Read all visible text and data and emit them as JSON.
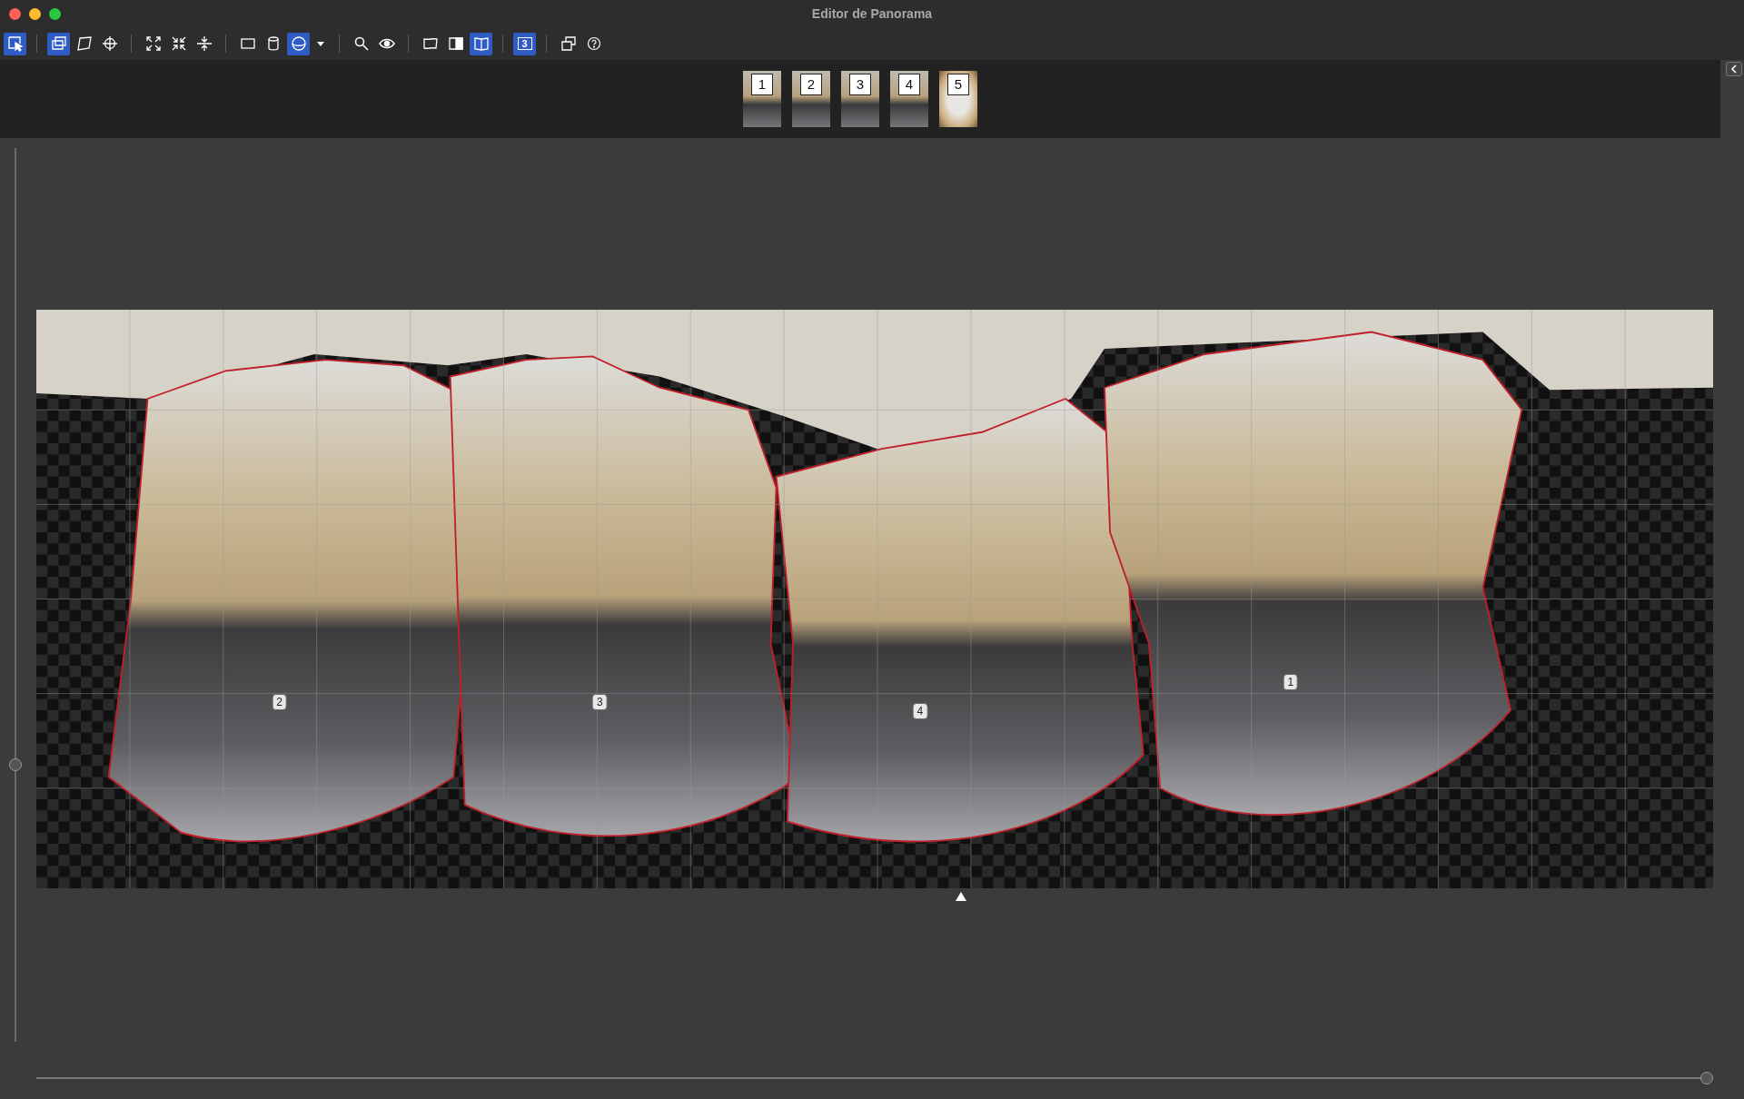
{
  "window": {
    "title": "Editor de Panorama"
  },
  "toolbar": [
    [
      {
        "kind": "select",
        "selected": true
      }
    ],
    [
      {
        "kind": "layers",
        "selected": true
      },
      {
        "kind": "quad",
        "selected": false
      },
      {
        "kind": "crosshair",
        "selected": false
      }
    ],
    [
      {
        "kind": "expand",
        "selected": false
      },
      {
        "kind": "compress",
        "selected": false
      },
      {
        "kind": "center",
        "selected": false
      }
    ],
    [
      {
        "kind": "rectangle",
        "selected": false
      },
      {
        "kind": "cylinder",
        "selected": false
      },
      {
        "kind": "sphere",
        "selected": true
      },
      {
        "kind": "caret",
        "selected": false
      }
    ],
    [
      {
        "kind": "search",
        "selected": false
      },
      {
        "kind": "eye",
        "selected": false
      }
    ],
    [
      {
        "kind": "warp",
        "selected": false
      },
      {
        "kind": "half",
        "selected": false
      },
      {
        "kind": "book",
        "selected": true
      }
    ],
    [
      {
        "kind": "number",
        "label": "3",
        "selected": true
      }
    ],
    [
      {
        "kind": "windows",
        "selected": false
      },
      {
        "kind": "help",
        "selected": false
      }
    ]
  ],
  "thumbnails": [
    {
      "label": "1",
      "kind": "hall"
    },
    {
      "label": "2",
      "kind": "hall"
    },
    {
      "label": "3",
      "kind": "hall"
    },
    {
      "label": "4",
      "kind": "hall"
    },
    {
      "label": "5",
      "kind": "ceiling"
    }
  ],
  "markers": [
    "1",
    "2",
    "3",
    "4"
  ],
  "vertical_slider": {
    "level": 0.31
  },
  "horizontal_slider": {
    "level": 1.0
  }
}
